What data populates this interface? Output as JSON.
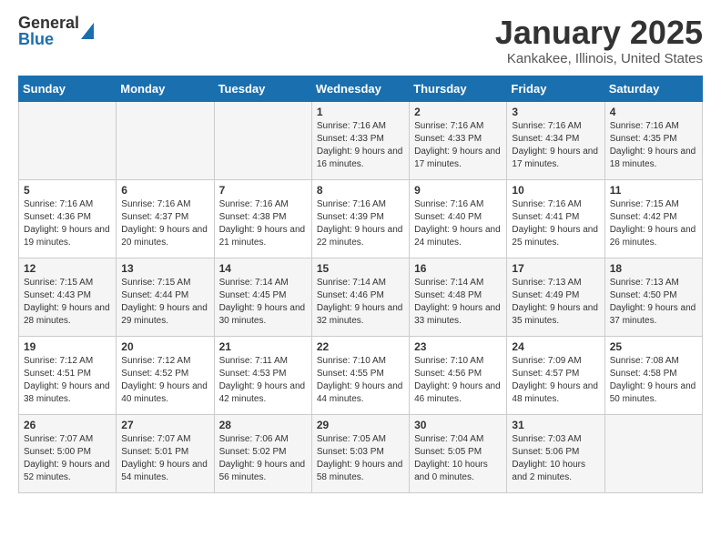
{
  "logo": {
    "general": "General",
    "blue": "Blue"
  },
  "header": {
    "month": "January 2025",
    "location": "Kankakee, Illinois, United States"
  },
  "weekdays": [
    "Sunday",
    "Monday",
    "Tuesday",
    "Wednesday",
    "Thursday",
    "Friday",
    "Saturday"
  ],
  "weeks": [
    [
      {
        "day": "",
        "sunrise": "",
        "sunset": "",
        "daylight": ""
      },
      {
        "day": "",
        "sunrise": "",
        "sunset": "",
        "daylight": ""
      },
      {
        "day": "",
        "sunrise": "",
        "sunset": "",
        "daylight": ""
      },
      {
        "day": "1",
        "sunrise": "Sunrise: 7:16 AM",
        "sunset": "Sunset: 4:33 PM",
        "daylight": "Daylight: 9 hours and 16 minutes."
      },
      {
        "day": "2",
        "sunrise": "Sunrise: 7:16 AM",
        "sunset": "Sunset: 4:33 PM",
        "daylight": "Daylight: 9 hours and 17 minutes."
      },
      {
        "day": "3",
        "sunrise": "Sunrise: 7:16 AM",
        "sunset": "Sunset: 4:34 PM",
        "daylight": "Daylight: 9 hours and 17 minutes."
      },
      {
        "day": "4",
        "sunrise": "Sunrise: 7:16 AM",
        "sunset": "Sunset: 4:35 PM",
        "daylight": "Daylight: 9 hours and 18 minutes."
      }
    ],
    [
      {
        "day": "5",
        "sunrise": "Sunrise: 7:16 AM",
        "sunset": "Sunset: 4:36 PM",
        "daylight": "Daylight: 9 hours and 19 minutes."
      },
      {
        "day": "6",
        "sunrise": "Sunrise: 7:16 AM",
        "sunset": "Sunset: 4:37 PM",
        "daylight": "Daylight: 9 hours and 20 minutes."
      },
      {
        "day": "7",
        "sunrise": "Sunrise: 7:16 AM",
        "sunset": "Sunset: 4:38 PM",
        "daylight": "Daylight: 9 hours and 21 minutes."
      },
      {
        "day": "8",
        "sunrise": "Sunrise: 7:16 AM",
        "sunset": "Sunset: 4:39 PM",
        "daylight": "Daylight: 9 hours and 22 minutes."
      },
      {
        "day": "9",
        "sunrise": "Sunrise: 7:16 AM",
        "sunset": "Sunset: 4:40 PM",
        "daylight": "Daylight: 9 hours and 24 minutes."
      },
      {
        "day": "10",
        "sunrise": "Sunrise: 7:16 AM",
        "sunset": "Sunset: 4:41 PM",
        "daylight": "Daylight: 9 hours and 25 minutes."
      },
      {
        "day": "11",
        "sunrise": "Sunrise: 7:15 AM",
        "sunset": "Sunset: 4:42 PM",
        "daylight": "Daylight: 9 hours and 26 minutes."
      }
    ],
    [
      {
        "day": "12",
        "sunrise": "Sunrise: 7:15 AM",
        "sunset": "Sunset: 4:43 PM",
        "daylight": "Daylight: 9 hours and 28 minutes."
      },
      {
        "day": "13",
        "sunrise": "Sunrise: 7:15 AM",
        "sunset": "Sunset: 4:44 PM",
        "daylight": "Daylight: 9 hours and 29 minutes."
      },
      {
        "day": "14",
        "sunrise": "Sunrise: 7:14 AM",
        "sunset": "Sunset: 4:45 PM",
        "daylight": "Daylight: 9 hours and 30 minutes."
      },
      {
        "day": "15",
        "sunrise": "Sunrise: 7:14 AM",
        "sunset": "Sunset: 4:46 PM",
        "daylight": "Daylight: 9 hours and 32 minutes."
      },
      {
        "day": "16",
        "sunrise": "Sunrise: 7:14 AM",
        "sunset": "Sunset: 4:48 PM",
        "daylight": "Daylight: 9 hours and 33 minutes."
      },
      {
        "day": "17",
        "sunrise": "Sunrise: 7:13 AM",
        "sunset": "Sunset: 4:49 PM",
        "daylight": "Daylight: 9 hours and 35 minutes."
      },
      {
        "day": "18",
        "sunrise": "Sunrise: 7:13 AM",
        "sunset": "Sunset: 4:50 PM",
        "daylight": "Daylight: 9 hours and 37 minutes."
      }
    ],
    [
      {
        "day": "19",
        "sunrise": "Sunrise: 7:12 AM",
        "sunset": "Sunset: 4:51 PM",
        "daylight": "Daylight: 9 hours and 38 minutes."
      },
      {
        "day": "20",
        "sunrise": "Sunrise: 7:12 AM",
        "sunset": "Sunset: 4:52 PM",
        "daylight": "Daylight: 9 hours and 40 minutes."
      },
      {
        "day": "21",
        "sunrise": "Sunrise: 7:11 AM",
        "sunset": "Sunset: 4:53 PM",
        "daylight": "Daylight: 9 hours and 42 minutes."
      },
      {
        "day": "22",
        "sunrise": "Sunrise: 7:10 AM",
        "sunset": "Sunset: 4:55 PM",
        "daylight": "Daylight: 9 hours and 44 minutes."
      },
      {
        "day": "23",
        "sunrise": "Sunrise: 7:10 AM",
        "sunset": "Sunset: 4:56 PM",
        "daylight": "Daylight: 9 hours and 46 minutes."
      },
      {
        "day": "24",
        "sunrise": "Sunrise: 7:09 AM",
        "sunset": "Sunset: 4:57 PM",
        "daylight": "Daylight: 9 hours and 48 minutes."
      },
      {
        "day": "25",
        "sunrise": "Sunrise: 7:08 AM",
        "sunset": "Sunset: 4:58 PM",
        "daylight": "Daylight: 9 hours and 50 minutes."
      }
    ],
    [
      {
        "day": "26",
        "sunrise": "Sunrise: 7:07 AM",
        "sunset": "Sunset: 5:00 PM",
        "daylight": "Daylight: 9 hours and 52 minutes."
      },
      {
        "day": "27",
        "sunrise": "Sunrise: 7:07 AM",
        "sunset": "Sunset: 5:01 PM",
        "daylight": "Daylight: 9 hours and 54 minutes."
      },
      {
        "day": "28",
        "sunrise": "Sunrise: 7:06 AM",
        "sunset": "Sunset: 5:02 PM",
        "daylight": "Daylight: 9 hours and 56 minutes."
      },
      {
        "day": "29",
        "sunrise": "Sunrise: 7:05 AM",
        "sunset": "Sunset: 5:03 PM",
        "daylight": "Daylight: 9 hours and 58 minutes."
      },
      {
        "day": "30",
        "sunrise": "Sunrise: 7:04 AM",
        "sunset": "Sunset: 5:05 PM",
        "daylight": "Daylight: 10 hours and 0 minutes."
      },
      {
        "day": "31",
        "sunrise": "Sunrise: 7:03 AM",
        "sunset": "Sunset: 5:06 PM",
        "daylight": "Daylight: 10 hours and 2 minutes."
      },
      {
        "day": "",
        "sunrise": "",
        "sunset": "",
        "daylight": ""
      }
    ]
  ]
}
